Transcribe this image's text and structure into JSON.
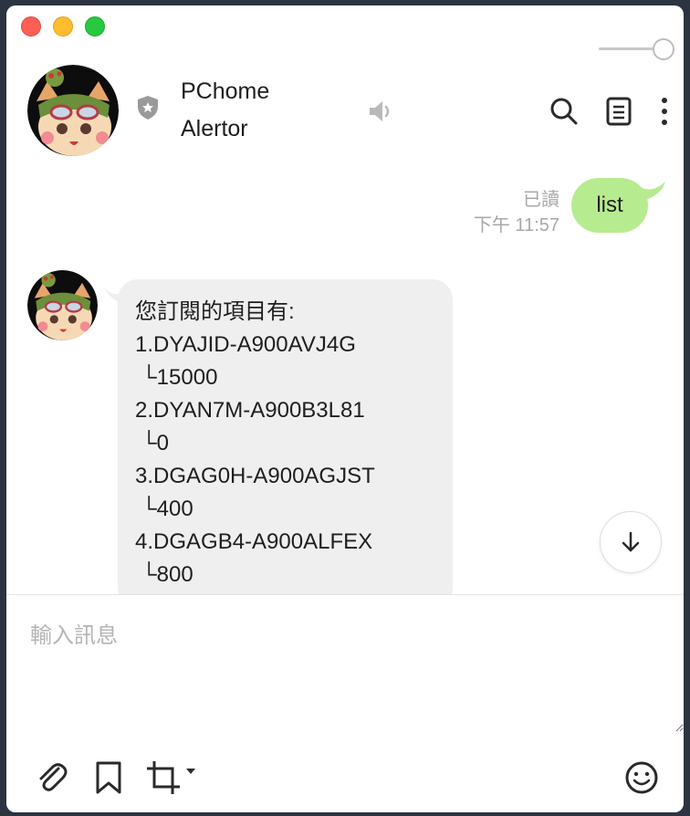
{
  "window": {
    "controls": [
      "close",
      "minimize",
      "maximize"
    ]
  },
  "header": {
    "title_line1": "PChome",
    "title_line2": "Alertor",
    "icons": {
      "avatar": "avatar",
      "badge": "shield-star-icon",
      "mute": "speaker-icon",
      "search": "search-icon",
      "notes": "notes-icon",
      "more": "more-vertical-icon"
    }
  },
  "messages": [
    {
      "side": "outgoing",
      "read_status": "已讀",
      "time": "下午 11:57",
      "text": "list",
      "color": "#b7eb8f"
    },
    {
      "side": "incoming",
      "color": "#efefef",
      "lines": [
        "您訂閱的項目有:",
        "1.DYAJID-A900AVJ4G",
        " └15000",
        "2.DYAN7M-A900B3L81",
        " └0",
        "3.DGAG0H-A900AGJST",
        " └400",
        "4.DGAGB4-A900ALFEX",
        " └800"
      ]
    }
  ],
  "composer": {
    "placeholder": "輸入訊息",
    "value": "",
    "toolbar": [
      "paperclip-icon",
      "bookmark-icon",
      "crop-icon",
      "emoji-icon"
    ]
  }
}
